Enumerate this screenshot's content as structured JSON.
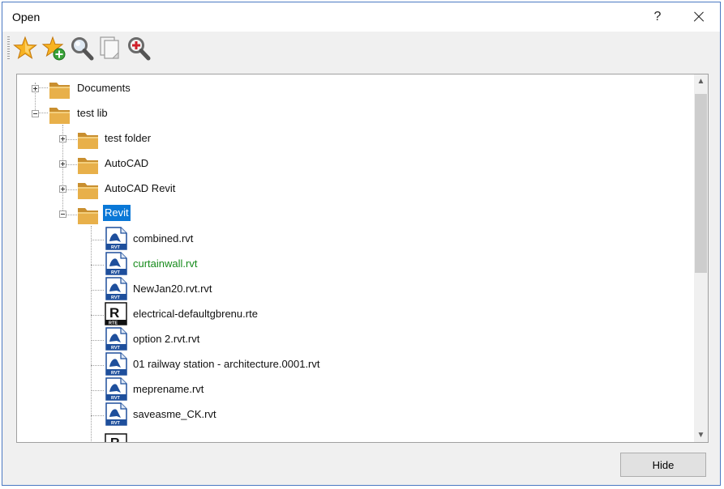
{
  "window": {
    "title": "Open",
    "help_label": "?"
  },
  "toolbar": {
    "buttons": [
      {
        "icon": "star-icon",
        "color": "#f5a623"
      },
      {
        "icon": "add-favorite-icon",
        "color": "#f5a623"
      },
      {
        "icon": "search-icon",
        "color": "#7a7a7a"
      },
      {
        "icon": "copy-pages-icon",
        "color": "#9a9a9a"
      },
      {
        "icon": "zoom-add-icon",
        "color": "#d0202a"
      }
    ]
  },
  "tree": {
    "roots": [
      {
        "label": "Documents",
        "expanded": false
      },
      {
        "label": "test lib",
        "expanded": true
      }
    ],
    "folders": [
      {
        "label": "test folder",
        "expanded": false
      },
      {
        "label": "AutoCAD",
        "expanded": false
      },
      {
        "label": "AutoCAD Revit",
        "expanded": false
      },
      {
        "label": "Revit",
        "expanded": true,
        "selected": true
      }
    ],
    "files": [
      {
        "label": "combined.rvt",
        "type": "rvt"
      },
      {
        "label": "curtainwall.rvt",
        "type": "rvt",
        "highlight": "#168b1b"
      },
      {
        "label": "NewJan20.rvt.rvt",
        "type": "rvt"
      },
      {
        "label": "electrical-defaultgbrenu.rte",
        "type": "rte"
      },
      {
        "label": "option 2.rvt.rvt",
        "type": "rvt"
      },
      {
        "label": "01 railway station - architecture.0001.rvt",
        "type": "rvt"
      },
      {
        "label": "meprename.rvt",
        "type": "rvt"
      },
      {
        "label": "saveasme_CK.rvt",
        "type": "rvt"
      }
    ]
  },
  "icons": {
    "folder": "folder-icon",
    "rvt": "rvt-file-icon",
    "rte": "rte-file-icon",
    "rvt_badge": "RVT",
    "rte_badge": "RTE"
  },
  "colors": {
    "selection": "#0a78d7",
    "folder": "#e8b04a",
    "rvt_blue": "#1e4f9c"
  },
  "footer": {
    "hide_label": "Hide"
  }
}
